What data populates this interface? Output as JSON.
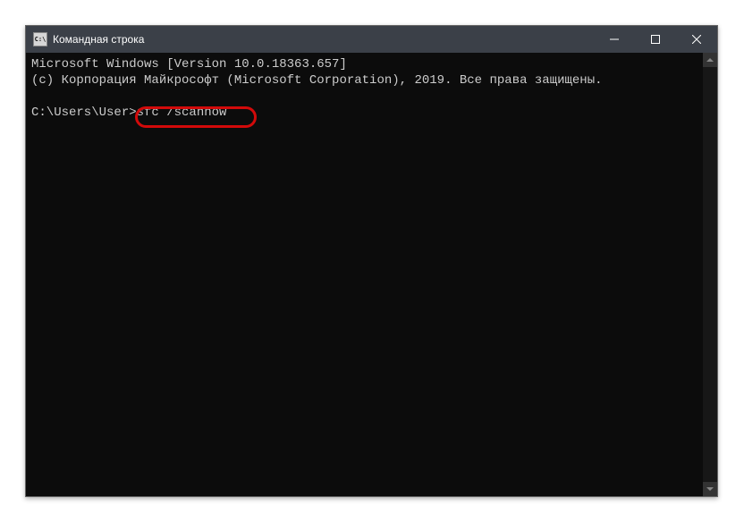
{
  "window": {
    "title": "Командная строка",
    "icon_label": "C:\\"
  },
  "terminal": {
    "line1": "Microsoft Windows [Version 10.0.18363.657]",
    "line2": "(c) Корпорация Майкрософт (Microsoft Corporation), 2019. Все права защищены.",
    "blank1": "",
    "prompt": "C:\\Users\\User>",
    "command": "sfc /scannow"
  }
}
